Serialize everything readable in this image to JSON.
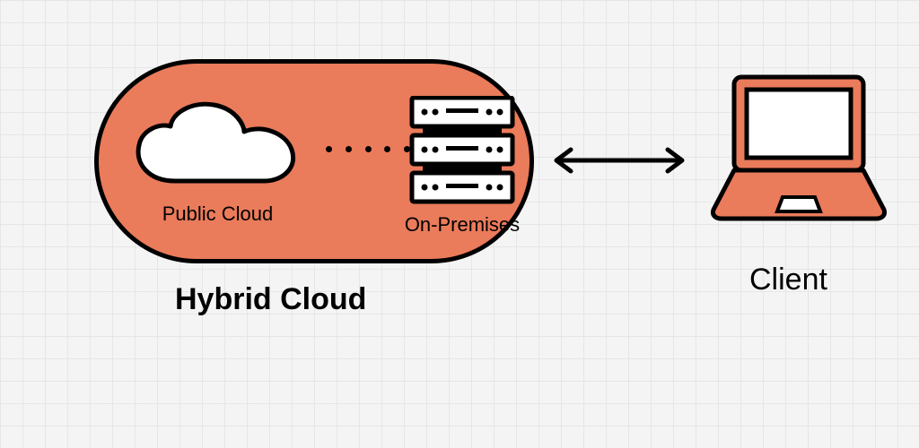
{
  "diagram": {
    "title": "Hybrid Cloud",
    "capsule": {
      "public_cloud_label": "Public Cloud",
      "on_premises_label": "On-Premises"
    },
    "client_label": "Client",
    "relations": [
      {
        "from": "public-cloud",
        "to": "on-premises",
        "style": "dotted"
      },
      {
        "from": "hybrid-cloud",
        "to": "client",
        "style": "bidirectional-arrow"
      }
    ],
    "colors": {
      "accent": "#ea7b5b",
      "stroke": "#000000",
      "bg": "#f4f4f4"
    }
  }
}
